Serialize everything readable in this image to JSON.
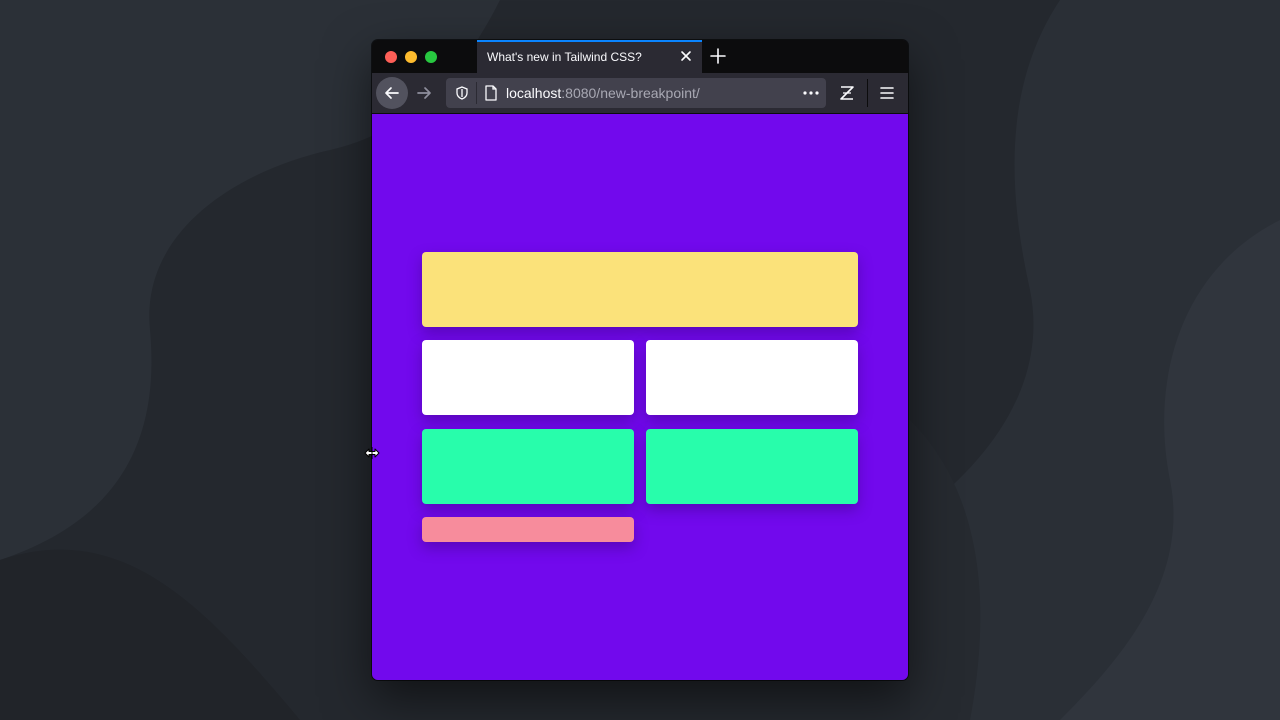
{
  "desktop": {
    "background_color": "#24282e"
  },
  "browser": {
    "tab": {
      "title": "What's new in Tailwind CSS?",
      "active_indicator_color": "#0a84ff"
    },
    "url": {
      "host": "localhost",
      "rest": ":8080/new-breakpoint/"
    },
    "icons": [
      "back-arrow-icon",
      "forward-arrow-icon",
      "tracking-protection-shield-icon",
      "page-icon",
      "more-actions-icon",
      "zotero-icon",
      "hamburger-menu-icon",
      "close-icon",
      "plus-icon"
    ]
  },
  "page": {
    "background_color": "#7209ed",
    "cards": [
      {
        "color": "#fbe27a"
      },
      {
        "color": "#ffffff"
      },
      {
        "color": "#ffffff"
      },
      {
        "color": "#28fdab"
      },
      {
        "color": "#28fdab"
      },
      {
        "color": "#f78c9c"
      }
    ]
  },
  "cursor": {
    "type": "horizontal-resize"
  }
}
